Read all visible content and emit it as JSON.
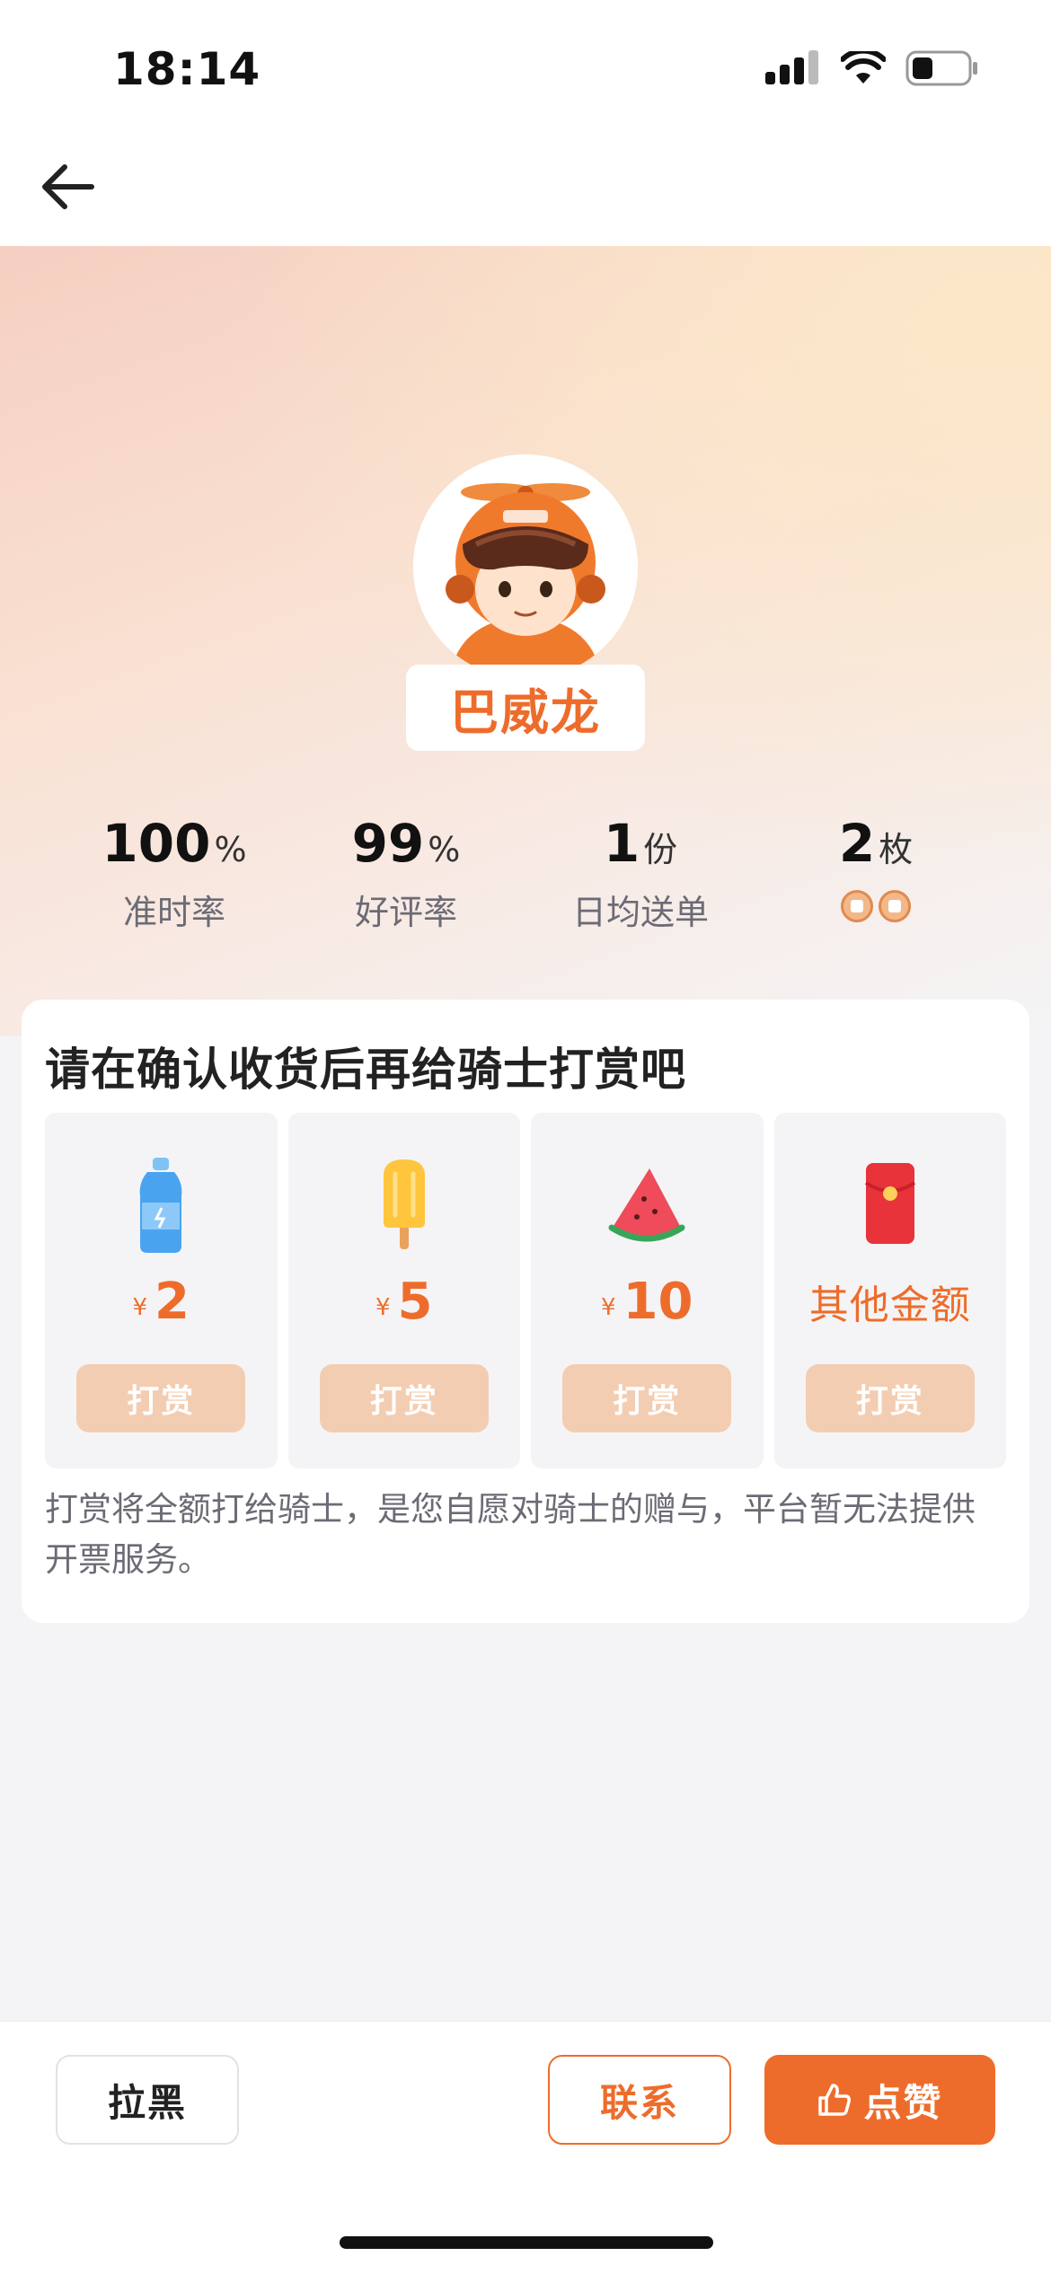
{
  "status_bar": {
    "time": "18:14",
    "icons": [
      "signal-icon",
      "wifi-icon",
      "battery-icon"
    ]
  },
  "nav": {
    "back_icon": "arrow-left-icon"
  },
  "rider": {
    "name": "巴威龙",
    "avatar": "rider-avatar"
  },
  "stats": [
    {
      "value": "100",
      "unit": "%",
      "label": "准时率"
    },
    {
      "value": "99",
      "unit": "%",
      "label": "好评率"
    },
    {
      "value": "1",
      "unit": "份",
      "label": "日均送单"
    },
    {
      "value": "2",
      "unit": "枚",
      "label": "",
      "icons": [
        "medal-icon",
        "medal-icon"
      ]
    }
  ],
  "tip_card": {
    "title": "请在确认收货后再给骑士打赏吧",
    "options": [
      {
        "icon": "water-bottle-icon",
        "currency": "¥",
        "amount": "2",
        "button": "打赏"
      },
      {
        "icon": "popsicle-icon",
        "currency": "¥",
        "amount": "5",
        "button": "打赏"
      },
      {
        "icon": "watermelon-icon",
        "currency": "¥",
        "amount": "10",
        "button": "打赏"
      },
      {
        "icon": "red-envelope-icon",
        "currency": "",
        "amount": "其他金额",
        "button": "打赏"
      }
    ],
    "note": "打赏将全额打给骑士，是您自愿对骑士的赠与，平台暂无法提供开票服务。"
  },
  "bottom_bar": {
    "block_label": "拉黑",
    "contact_label": "联系",
    "like_label": "点赞",
    "like_icon": "thumbs-up-icon"
  },
  "colors": {
    "accent": "#ee6c2b",
    "tip_button": "#f3cdb2"
  }
}
